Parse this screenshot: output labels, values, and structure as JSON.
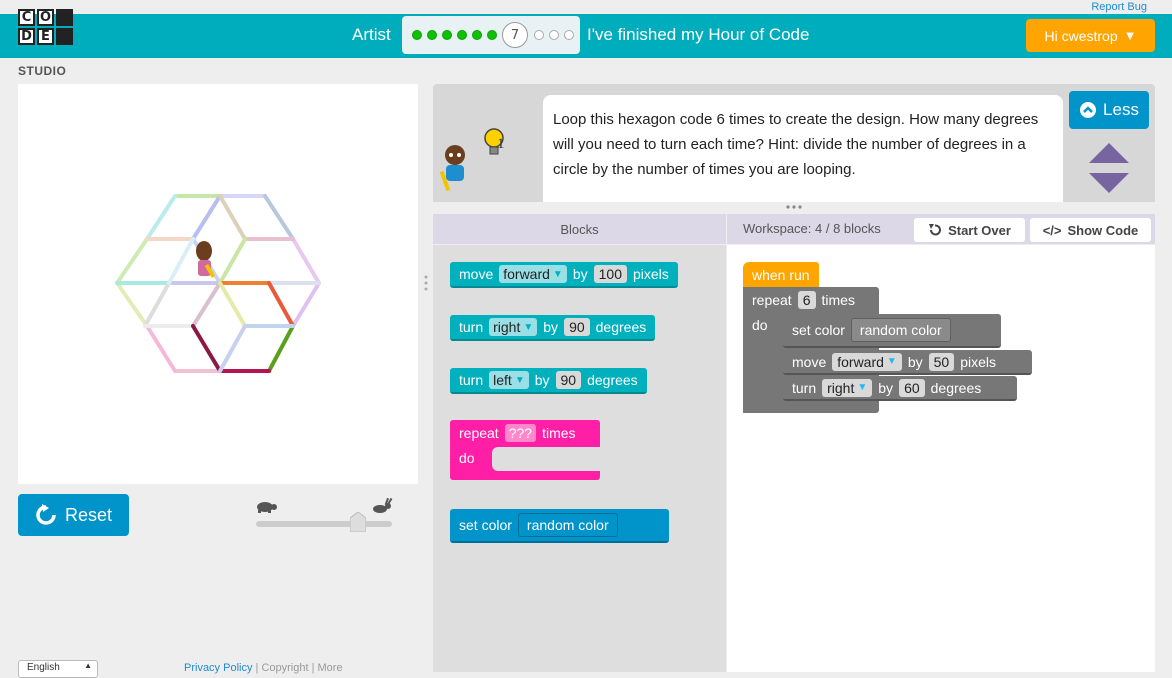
{
  "header": {
    "report_bug": "Report Bug",
    "logo_letters": [
      "C",
      "O",
      "D",
      "E"
    ],
    "logo_studio": "STUDIO",
    "stage_title": "Artist",
    "progress": {
      "current_puzzle": "7",
      "completed": 6,
      "remaining": 3
    },
    "finished_link": "I've finished my Hour of Code",
    "user_button": "Hi cwestrop",
    "user_caret": "▼"
  },
  "instructions": {
    "text": "Loop this hexagon code 6 times to create the design. How many degrees will you need to turn each time? Hint: divide the number of degrees in a circle by the number of times you are looping.",
    "hint_count": "1",
    "less_button": "Less"
  },
  "controls": {
    "reset_label": "Reset",
    "speed_level": 0.75
  },
  "toolbox": {
    "title": "Blocks",
    "blocks": {
      "move": {
        "keyword": "move",
        "direction": "forward",
        "by": "by",
        "value": "100",
        "unit": "pixels"
      },
      "turn_right": {
        "keyword": "turn",
        "direction": "right",
        "by": "by",
        "value": "90",
        "unit": "degrees"
      },
      "turn_left": {
        "keyword": "turn",
        "direction": "left",
        "by": "by",
        "value": "90",
        "unit": "degrees"
      },
      "repeat": {
        "keyword": "repeat",
        "value": "???",
        "unit": "times",
        "do": "do"
      },
      "set_color": {
        "keyword": "set color",
        "value": "random color"
      }
    }
  },
  "workspace": {
    "count_label": "Workspace: 4 / 8 blocks",
    "start_over": "Start Over",
    "show_code": "Show Code",
    "program": {
      "when_run": "when run",
      "repeat": {
        "keyword": "repeat",
        "value": "6",
        "unit": "times",
        "do": "do"
      },
      "set_color": {
        "keyword": "set color",
        "value": "random color"
      },
      "move": {
        "keyword": "move",
        "direction": "forward",
        "by": "by",
        "value": "50",
        "unit": "pixels"
      },
      "turn": {
        "keyword": "turn",
        "direction": "right",
        "by": "by",
        "value": "60",
        "unit": "degrees"
      }
    }
  },
  "footer": {
    "language": "English",
    "links": [
      "Privacy Policy",
      "Copyright",
      "More"
    ]
  },
  "colors": {
    "header_teal": "#00adbc",
    "user_orange": "#ffa400",
    "action_blue": "#0094ca",
    "block_teal": "#00b0bd",
    "loop_pink": "#ff1fa6",
    "event_orange": "#ffa500",
    "workspace_grey": "#777777",
    "progress_green": "#0ec107"
  }
}
